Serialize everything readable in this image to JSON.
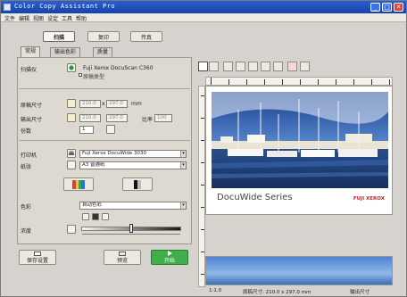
{
  "window": {
    "title": "Color Copy Assistant Pro",
    "minimize_glyph": "_",
    "maximize_glyph": "□",
    "close_glyph": "✕"
  },
  "menu": [
    "文件",
    "编辑",
    "视图",
    "设定",
    "工具",
    "帮助"
  ],
  "mode_buttons": [
    "扫描",
    "复印",
    "传真"
  ],
  "tabs": [
    "常规",
    "输出色彩",
    "质量"
  ],
  "scanner": {
    "label": "扫描仪",
    "device_name": "Fuji Xerox DocuScan C360",
    "option_label": "原稿类型"
  },
  "scan_size": {
    "label": "原稿尺寸",
    "width_value": "210.0",
    "height_value": "297.0",
    "unit": "mm"
  },
  "output_size": {
    "label": "输出尺寸",
    "width_value": "210.0",
    "height_value": "297.0",
    "ratio_label": "比率",
    "ratio_value": "100"
  },
  "copies": {
    "label": "份数",
    "value": "1"
  },
  "printer": {
    "label": "打印机",
    "device_name": "Fuji Xerox DocuWide 3030",
    "paper_label": "纸张",
    "paper_value": "A3 普通纸"
  },
  "color": {
    "label": "色彩",
    "value": "自动色彩",
    "density_label": "浓度"
  },
  "bottom_buttons": {
    "save_label": "保存设置",
    "preview_label": "预览",
    "start_label": "开始"
  },
  "preview": {
    "banner_title": "DocuWide Series",
    "banner_brand": "FUJI XEROX"
  },
  "status": {
    "zoom": "1:1.0",
    "scan_size_text": "原稿尺寸: 210.0 x 297.0 mm",
    "output_text": "输出尺寸"
  },
  "colors": {
    "title_bar": "#1d4fbf",
    "start_button": "#3fae4b",
    "brand_red": "#c0262d"
  },
  "icons": [
    "app-icon",
    "select-icon",
    "zoom-in-icon",
    "zoom-out-icon",
    "fit-icon",
    "rotate-icon",
    "hand-icon",
    "color-icon",
    "mono-icon",
    "scanner-icon",
    "printer-icon"
  ]
}
